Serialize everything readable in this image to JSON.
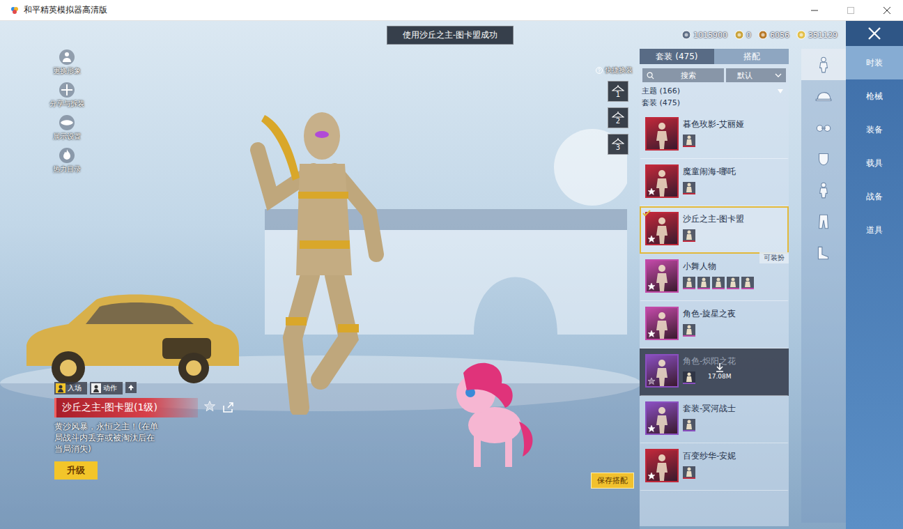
{
  "window": {
    "title": "和平精英模拟器高清版"
  },
  "toast": "使用沙丘之主-图卡盟成功",
  "currencies": [
    {
      "value": "1015900",
      "color": "#5f6f86"
    },
    {
      "value": "0",
      "color": "#c9a33a"
    },
    {
      "value": "6056",
      "color": "#b87a2a"
    },
    {
      "value": "351129",
      "color": "#e3c04a"
    }
  ],
  "left_menu": [
    {
      "label": "更换形象"
    },
    {
      "label": "分享与拆装"
    },
    {
      "label": "展示设置"
    },
    {
      "label": "热力目录"
    }
  ],
  "quick_change": {
    "label": "快捷换装",
    "slots": [
      {
        "number": "1",
        "selected": false
      },
      {
        "number": "2",
        "selected": false
      },
      {
        "number": "3",
        "selected": false
      }
    ]
  },
  "panel": {
    "tabs": [
      {
        "label": "套装 (475)",
        "selected": true
      },
      {
        "label": "搭配",
        "selected": false
      }
    ],
    "search": {
      "placeholder": "搜索"
    },
    "sort": {
      "value": "默认"
    },
    "groups": [
      {
        "label": "主题 (166)",
        "expanded": false
      },
      {
        "label": "套装 (475)",
        "expanded": true
      }
    ],
    "items": [
      {
        "name": "暮色玫影-艾丽娅",
        "color": "#c0283a",
        "favorite": false,
        "parts": 1,
        "selected": false,
        "downloading": false
      },
      {
        "name": "魔童闹海-哪吒",
        "color": "#c0283a",
        "favorite": true,
        "parts": 1,
        "selected": false,
        "downloading": false
      },
      {
        "name": "沙丘之主-图卡盟",
        "color": "#c0283a",
        "favorite": true,
        "parts": 1,
        "selected": true,
        "downloading": false,
        "status": "可装扮"
      },
      {
        "name": "小舞人物",
        "color": "#c24aa8",
        "favorite": true,
        "parts": 5,
        "selected": false,
        "downloading": false
      },
      {
        "name": "角色-旋星之夜",
        "color": "#c24aa8",
        "favorite": true,
        "parts": 1,
        "selected": false,
        "downloading": false
      },
      {
        "name": "角色-炽阳之花",
        "color": "#8a4fc0",
        "favorite": false,
        "parts": 1,
        "selected": false,
        "downloading": true,
        "size": "17.08M"
      },
      {
        "name": "套装-冥河战士",
        "color": "#8a4fc0",
        "favorite": true,
        "parts": 1,
        "selected": false,
        "downloading": false
      },
      {
        "name": "百变纱华-安妮",
        "color": "#c0283a",
        "favorite": true,
        "parts": 1,
        "selected": false,
        "downloading": false
      }
    ]
  },
  "side_tabs": [
    {
      "kind": "outfit",
      "selected": true
    },
    {
      "kind": "hat",
      "selected": false
    },
    {
      "kind": "glasses",
      "selected": false
    },
    {
      "kind": "mask",
      "selected": false
    },
    {
      "kind": "top",
      "selected": false
    },
    {
      "kind": "pants",
      "selected": false
    },
    {
      "kind": "shoes",
      "selected": false
    }
  ],
  "categories": [
    {
      "label": "时装",
      "selected": true
    },
    {
      "label": "枪械",
      "selected": false
    },
    {
      "label": "装备",
      "selected": false
    },
    {
      "label": "载具",
      "selected": false
    },
    {
      "label": "战备",
      "selected": false
    },
    {
      "label": "道具",
      "selected": false
    }
  ],
  "detail": {
    "tabs": [
      {
        "label": "入场"
      },
      {
        "label": "动作"
      }
    ],
    "title": "沙丘之主-图卡盟(1级)",
    "favorite": false,
    "description": "黄沙风暴，永恒之主！(在单局战斗内丢弃或被淘汰后在当局消失)",
    "upgrade": "升级"
  },
  "save": "保存搭配"
}
